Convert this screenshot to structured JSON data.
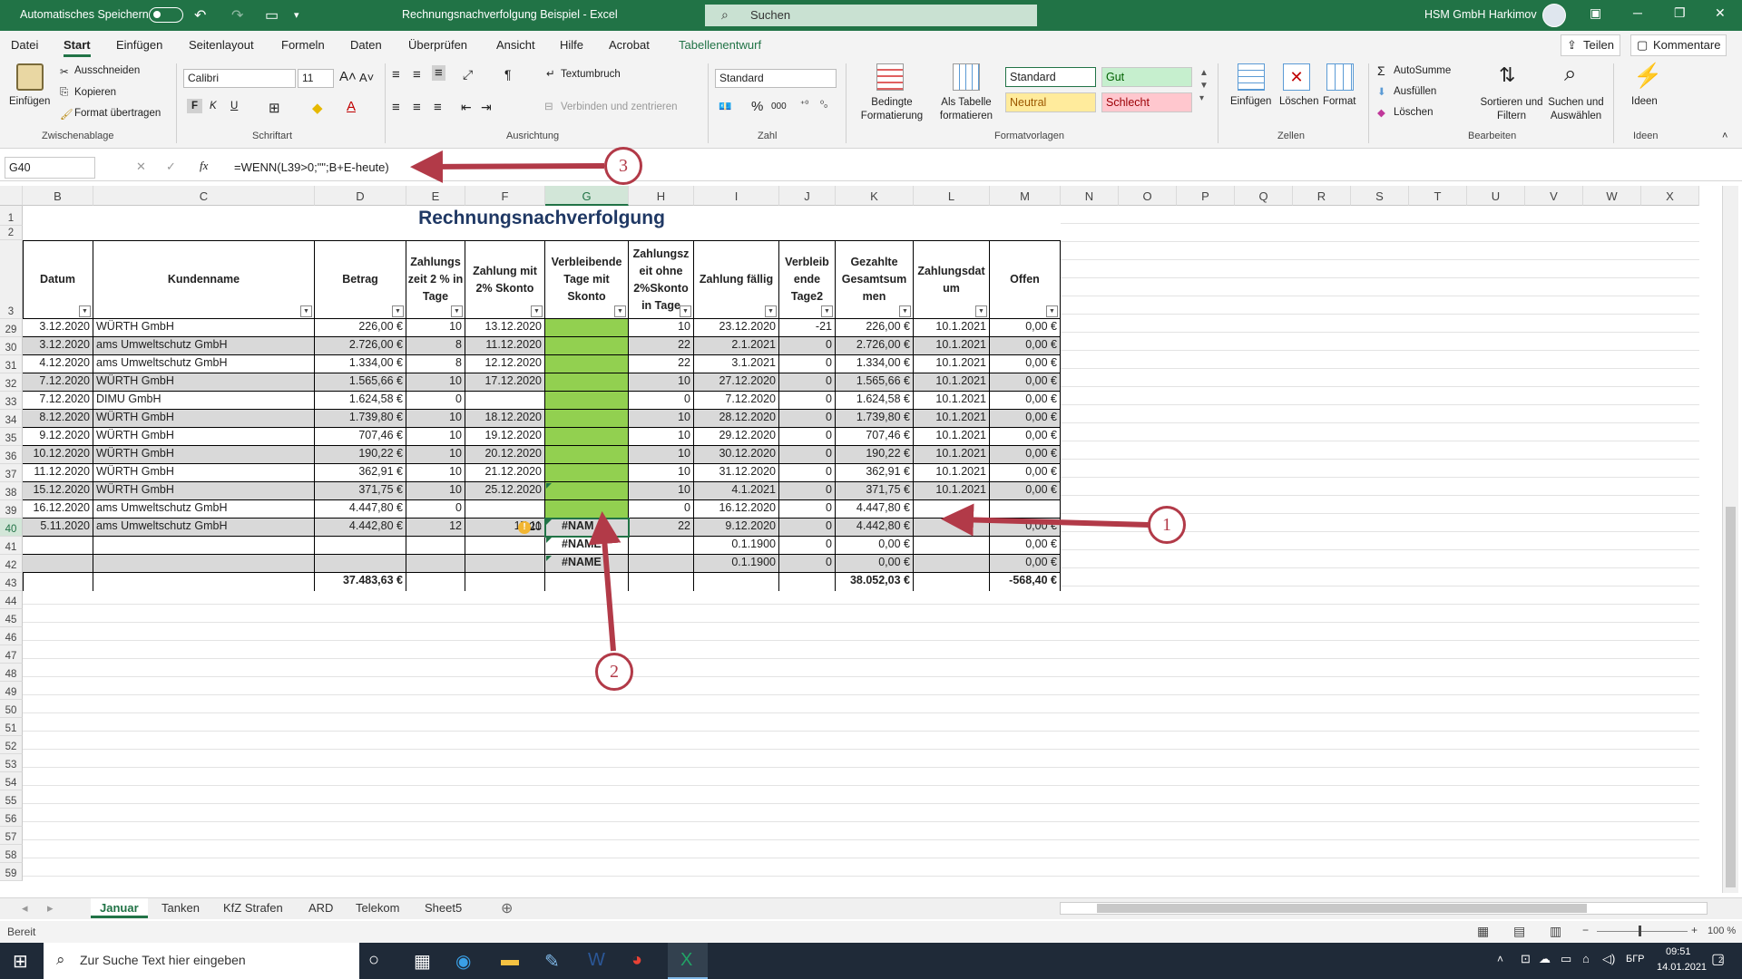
{
  "titlebar": {
    "autosave": "Automatisches Speichern",
    "title": "Rechnungsnachverfolgung Beispiel  -  Excel",
    "search": "Suchen",
    "user": "HSM GmbH Harkimov"
  },
  "menu": {
    "items": [
      "Datei",
      "Start",
      "Einfügen",
      "Seitenlayout",
      "Formeln",
      "Daten",
      "Überprüfen",
      "Ansicht",
      "Hilfe",
      "Acrobat",
      "Tabellenentwurf"
    ],
    "share": "Teilen",
    "comments": "Kommentare"
  },
  "ribbon": {
    "clipboard": {
      "label": "Zwischenablage",
      "paste": "Einfügen",
      "cut": "Ausschneiden",
      "copy": "Kopieren",
      "format_painter": "Format übertragen"
    },
    "font": {
      "label": "Schriftart",
      "name": "Calibri",
      "size": "11",
      "bold": "F",
      "italic": "K",
      "underline": "U"
    },
    "alignment": {
      "label": "Ausrichtung",
      "wrap": "Textumbruch",
      "merge": "Verbinden und zentrieren"
    },
    "number": {
      "label": "Zahl",
      "format": "Standard"
    },
    "styles": {
      "label": "Formatvorlagen",
      "cond": "Bedingte Formatierung",
      "astable": "Als Tabelle formatieren",
      "standard": "Standard",
      "gut": "Gut",
      "neutral": "Neutral",
      "schlecht": "Schlecht"
    },
    "cells": {
      "label": "Zellen",
      "insert": "Einfügen",
      "delete": "Löschen",
      "format": "Format"
    },
    "edit": {
      "label": "Bearbeiten",
      "autosum": "AutoSumme",
      "fill": "Ausfüllen",
      "clear": "Löschen",
      "sort": "Sortieren und Filtern",
      "find": "Suchen und Auswählen"
    },
    "ideas": {
      "label": "Ideen",
      "btn": "Ideen"
    }
  },
  "formula": {
    "namebox": "G40",
    "content": "=WENN(L39>0;\"\";B+E-heute)"
  },
  "columns": [
    "B",
    "C",
    "D",
    "E",
    "F",
    "G",
    "H",
    "I",
    "J",
    "K",
    "L",
    "M",
    "N",
    "O",
    "P",
    "Q",
    "R",
    "S",
    "T",
    "U",
    "V",
    "W",
    "X"
  ],
  "sheet_title": "Rechnungsnachverfolgung",
  "table_headers": [
    "Datum",
    "Kundenname",
    "Betrag",
    "Zahlungs zeit 2 % in Tage",
    "Zahlung mit 2% Skonto",
    "Verbleibende Tage mit Skonto",
    "Zahlungsz eit ohne 2%Skonto in Tage",
    "Zahlung fällig",
    "Verbleib ende Tage2",
    "Gezahlte Gesamtsum men",
    "Zahlungsdat um",
    "Offen"
  ],
  "rows": [
    {
      "r": "29",
      "b": "3.12.2020",
      "c": "WÜRTH GmbH",
      "d": "226,00 €",
      "e": "10",
      "f": "13.12.2020",
      "g": "",
      "h": "10",
      "i": "23.12.2020",
      "j": "-21",
      "k": "226,00 €",
      "l": "10.1.2021",
      "m": "0,00 €"
    },
    {
      "r": "30",
      "b": "3.12.2020",
      "c": "ams Umweltschutz GmbH",
      "d": "2.726,00 €",
      "e": "8",
      "f": "11.12.2020",
      "g": "",
      "h": "22",
      "i": "2.1.2021",
      "j": "0",
      "k": "2.726,00 €",
      "l": "10.1.2021",
      "m": "0,00 €"
    },
    {
      "r": "31",
      "b": "4.12.2020",
      "c": "ams Umweltschutz GmbH",
      "d": "1.334,00 €",
      "e": "8",
      "f": "12.12.2020",
      "g": "",
      "h": "22",
      "i": "3.1.2021",
      "j": "0",
      "k": "1.334,00 €",
      "l": "10.1.2021",
      "m": "0,00 €"
    },
    {
      "r": "32",
      "b": "7.12.2020",
      "c": "WÜRTH GmbH",
      "d": "1.565,66 €",
      "e": "10",
      "f": "17.12.2020",
      "g": "",
      "h": "10",
      "i": "27.12.2020",
      "j": "0",
      "k": "1.565,66 €",
      "l": "10.1.2021",
      "m": "0,00 €"
    },
    {
      "r": "33",
      "b": "7.12.2020",
      "c": "DIMU GmbH",
      "d": "1.624,58 €",
      "e": "0",
      "f": "",
      "g": "",
      "h": "0",
      "i": "7.12.2020",
      "j": "0",
      "k": "1.624,58 €",
      "l": "10.1.2021",
      "m": "0,00 €"
    },
    {
      "r": "34",
      "b": "8.12.2020",
      "c": "WÜRTH GmbH",
      "d": "1.739,80 €",
      "e": "10",
      "f": "18.12.2020",
      "g": "",
      "h": "10",
      "i": "28.12.2020",
      "j": "0",
      "k": "1.739,80 €",
      "l": "10.1.2021",
      "m": "0,00 €"
    },
    {
      "r": "35",
      "b": "9.12.2020",
      "c": "WÜRTH GmbH",
      "d": "707,46 €",
      "e": "10",
      "f": "19.12.2020",
      "g": "",
      "h": "10",
      "i": "29.12.2020",
      "j": "0",
      "k": "707,46 €",
      "l": "10.1.2021",
      "m": "0,00 €"
    },
    {
      "r": "36",
      "b": "10.12.2020",
      "c": "WÜRTH GmbH",
      "d": "190,22 €",
      "e": "10",
      "f": "20.12.2020",
      "g": "",
      "h": "10",
      "i": "30.12.2020",
      "j": "0",
      "k": "190,22 €",
      "l": "10.1.2021",
      "m": "0,00 €"
    },
    {
      "r": "37",
      "b": "11.12.2020",
      "c": "WÜRTH GmbH",
      "d": "362,91 €",
      "e": "10",
      "f": "21.12.2020",
      "g": "",
      "h": "10",
      "i": "31.12.2020",
      "j": "0",
      "k": "362,91 €",
      "l": "10.1.2021",
      "m": "0,00 €"
    },
    {
      "r": "38",
      "b": "15.12.2020",
      "c": "WÜRTH GmbH",
      "d": "371,75 €",
      "e": "10",
      "f": "25.12.2020",
      "g": "",
      "h": "10",
      "i": "4.1.2021",
      "j": "0",
      "k": "371,75 €",
      "l": "10.1.2021",
      "m": "0,00 €"
    },
    {
      "r": "39",
      "b": "16.12.2020",
      "c": "ams Umweltschutz GmbH",
      "d": "4.447,80 €",
      "e": "0",
      "f": "",
      "g": "",
      "h": "0",
      "i": "16.12.2020",
      "j": "0",
      "k": "4.447,80 €",
      "l": "",
      "m": ""
    },
    {
      "r": "40",
      "b": "5.11.2020",
      "c": "ams Umweltschutz GmbH",
      "d": "4.442,80 €",
      "e": "12",
      "f": "17.11",
      "f2": "20",
      "g": "#NAM",
      "h": "22",
      "i": "9.12.2020",
      "j": "0",
      "k": "4.442,80 €",
      "l": "",
      "m": "0,00 €"
    },
    {
      "r": "41",
      "b": "",
      "c": "",
      "d": "",
      "e": "",
      "f": "",
      "g": "#NAME",
      "h": "",
      "i": "0.1.1900",
      "j": "0",
      "k": "0,00 €",
      "l": "",
      "m": "0,00 €"
    },
    {
      "r": "42",
      "b": "",
      "c": "",
      "d": "",
      "e": "",
      "f": "",
      "g": "#NAME",
      "h": "",
      "i": "0.1.1900",
      "j": "0",
      "k": "0,00 €",
      "l": "",
      "m": "0,00 €"
    }
  ],
  "totals": {
    "r": "43",
    "d": "37.483,63 €",
    "k": "38.052,03 €",
    "m": "-568,40 €"
  },
  "empty_rows": [
    "44",
    "45",
    "46",
    "47",
    "48",
    "49",
    "50",
    "51",
    "52",
    "53",
    "54",
    "55",
    "56",
    "57",
    "58",
    "59"
  ],
  "title_rows": [
    "1",
    "2",
    "3"
  ],
  "annotations": [
    "1",
    "2",
    "3"
  ],
  "sheet_tabs": [
    "Januar",
    "Tanken",
    "KfZ Strafen",
    "ARD",
    "Telekom",
    "Sheet5"
  ],
  "status": {
    "ready": "Bereit",
    "zoom": "100 %"
  },
  "taskbar": {
    "search": "Zur Suche Text hier eingeben",
    "lang": "БГР",
    "time": "09:51",
    "date": "14.01.2021",
    "notif": "2"
  },
  "colors": {
    "excel_green": "#217346",
    "fill_green": "#92d050",
    "annotation": "#b23a48"
  }
}
